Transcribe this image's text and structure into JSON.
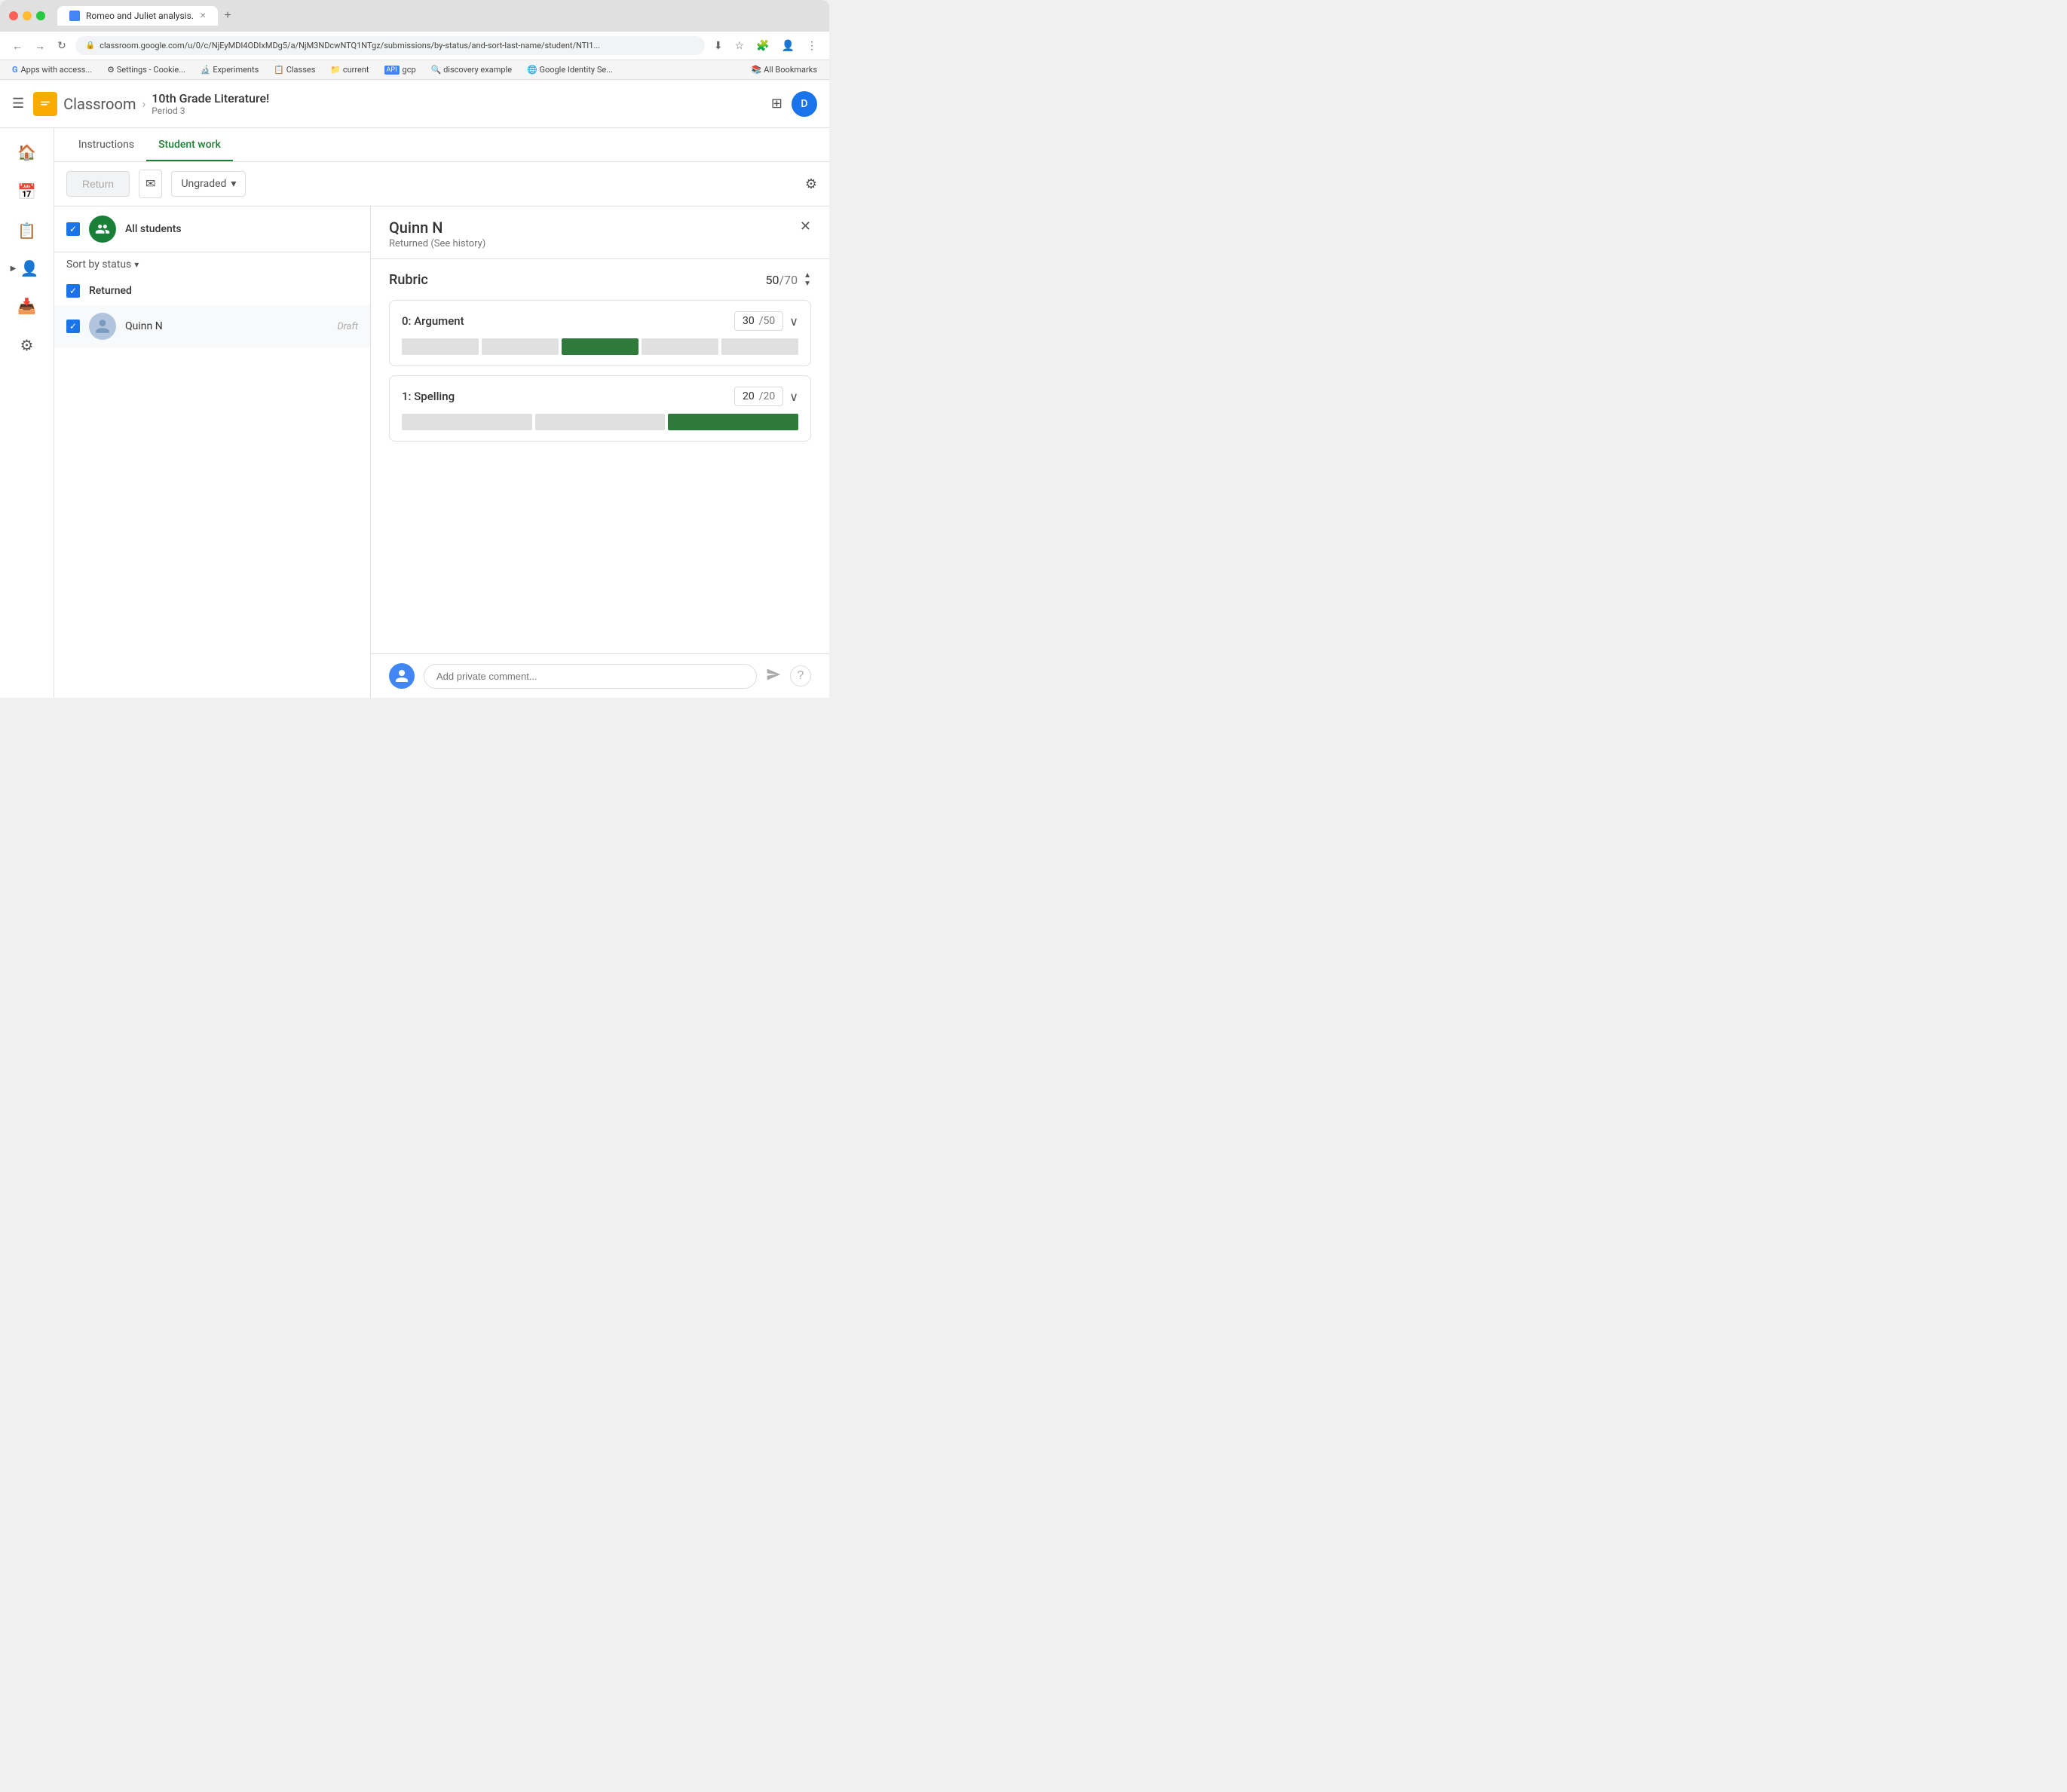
{
  "browser": {
    "tab_title": "Romeo and Juliet analysis.",
    "url": "classroom.google.com/u/0/c/NjEyMDI4ODIxMDg5/a/NjM3NDcwNTQ1NTgz/submissions/by-status/and-sort-last-name/student/NTI1...",
    "bookmarks": [
      {
        "label": "Apps with access...",
        "icon": "G"
      },
      {
        "label": "Settings - Cookie...",
        "icon": "⚙"
      },
      {
        "label": "Experiments",
        "icon": "🔬"
      },
      {
        "label": "Classes",
        "icon": "📋"
      },
      {
        "label": "current",
        "icon": "📁"
      },
      {
        "label": "gcp",
        "icon": "api"
      },
      {
        "label": "discovery example",
        "icon": "🔍"
      },
      {
        "label": "Google Identity Se...",
        "icon": "🌐"
      },
      {
        "label": "All Bookmarks",
        "icon": "📚"
      }
    ]
  },
  "app": {
    "name": "Classroom",
    "course_title": "10th Grade Literature!",
    "course_period": "Period 3",
    "user_initial": "D"
  },
  "tabs": [
    {
      "label": "Instructions",
      "active": false
    },
    {
      "label": "Student work",
      "active": true
    }
  ],
  "toolbar": {
    "return_label": "Return",
    "ungraded_label": "Ungraded"
  },
  "student_list": {
    "all_students_label": "All students",
    "sort_label": "Sort by status",
    "sections": [
      {
        "status": "Returned",
        "students": [
          {
            "name": "Quinn N",
            "status": "Draft"
          }
        ]
      }
    ]
  },
  "detail": {
    "student_name": "Quinn N",
    "student_status": "Returned (See history)",
    "rubric_title": "Rubric",
    "rubric_score": "50",
    "rubric_total": "70",
    "criteria": [
      {
        "name": "0: Argument",
        "score": "30",
        "total": "50",
        "bar_segments": 5,
        "active_segment": 2
      },
      {
        "name": "1: Spelling",
        "score": "20",
        "total": "20",
        "bar_segments": 3,
        "active_segment": 2
      }
    ],
    "comment_placeholder": "Add private comment..."
  },
  "sidebar": {
    "items": [
      {
        "icon": "🏠",
        "name": "home"
      },
      {
        "icon": "📅",
        "name": "calendar"
      },
      {
        "icon": "📋",
        "name": "assignments"
      },
      {
        "icon": "👤",
        "name": "people"
      },
      {
        "icon": "📥",
        "name": "archive"
      },
      {
        "icon": "⚙",
        "name": "settings"
      }
    ]
  }
}
